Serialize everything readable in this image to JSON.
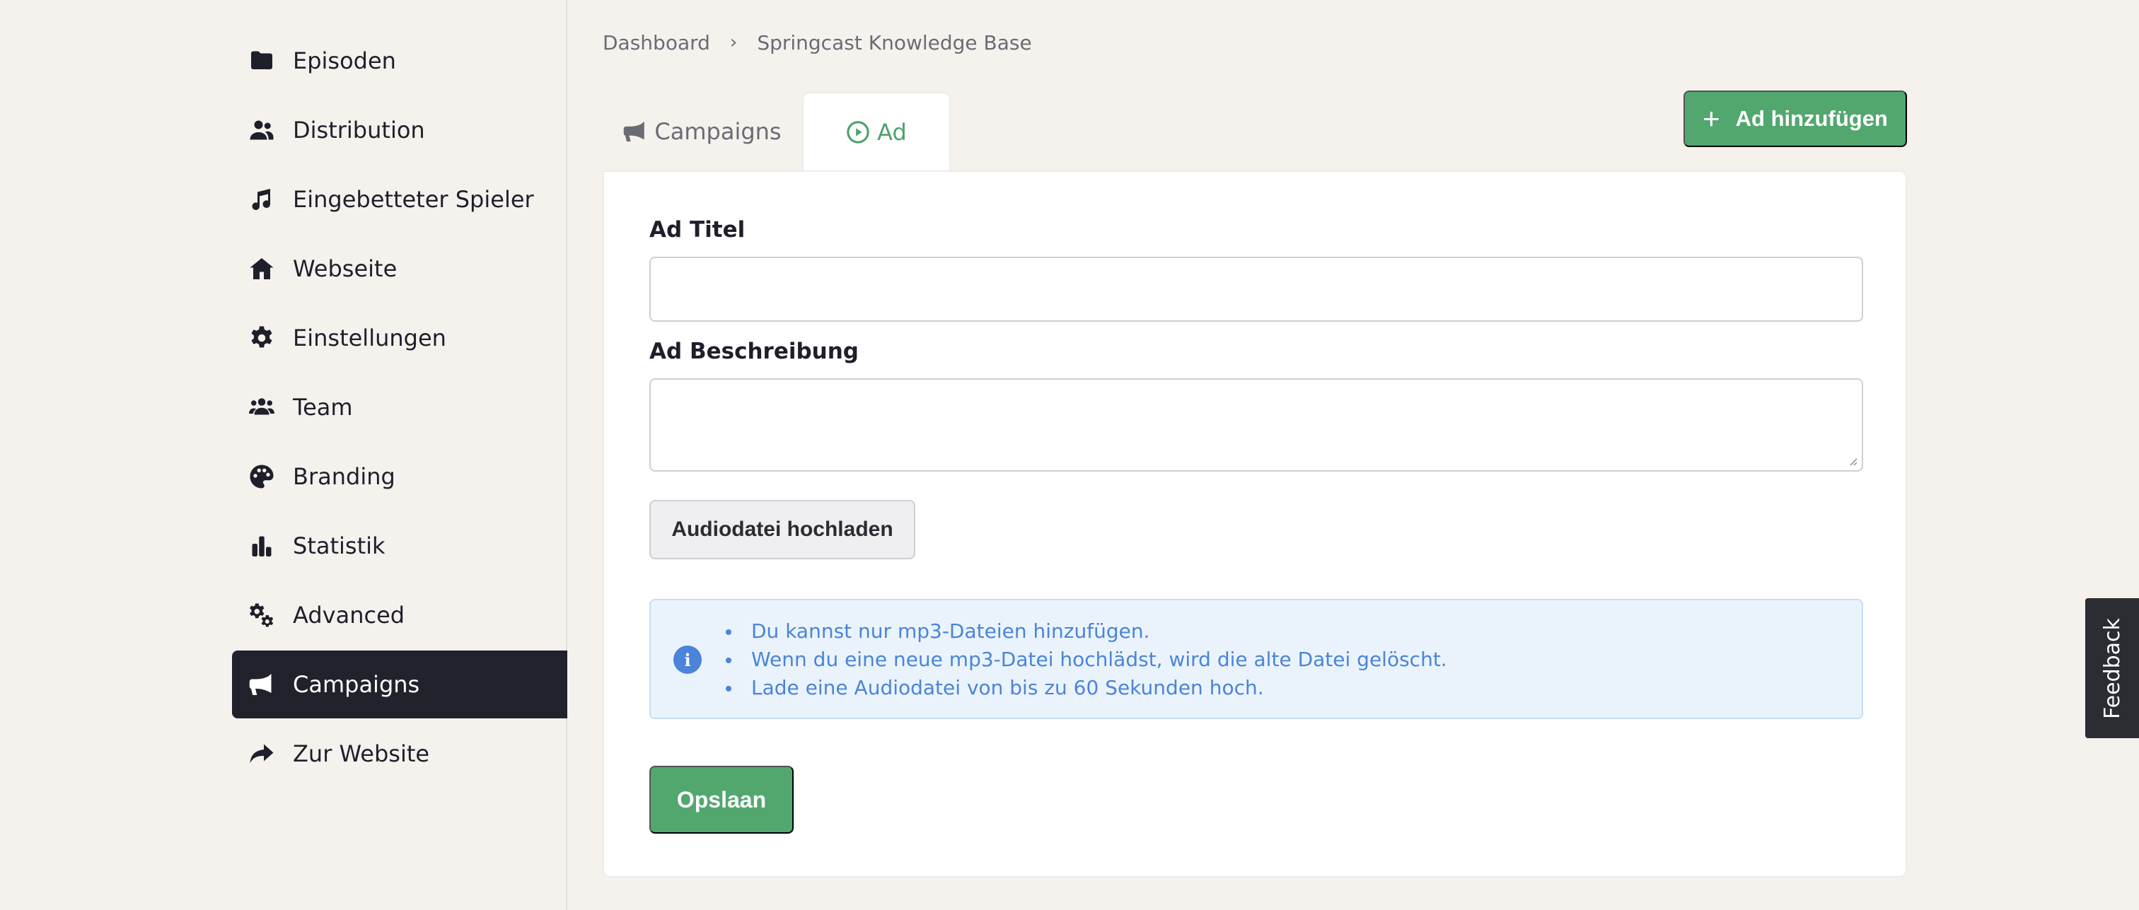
{
  "sidebar": {
    "items": [
      {
        "label": "Episoden",
        "icon": "folder-icon"
      },
      {
        "label": "Distribution",
        "icon": "users-icon"
      },
      {
        "label": "Eingebetteter Spieler",
        "icon": "music-icon"
      },
      {
        "label": "Webseite",
        "icon": "home-icon"
      },
      {
        "label": "Einstellungen",
        "icon": "gear-icon"
      },
      {
        "label": "Team",
        "icon": "team-icon"
      },
      {
        "label": "Branding",
        "icon": "palette-icon"
      },
      {
        "label": "Statistik",
        "icon": "bar-chart-icon"
      },
      {
        "label": "Advanced",
        "icon": "gears-icon"
      },
      {
        "label": "Campaigns",
        "icon": "megaphone-icon",
        "active": true
      },
      {
        "label": "Zur Website",
        "icon": "share-arrow-icon"
      }
    ]
  },
  "breadcrumb": {
    "items": [
      "Dashboard",
      "Springcast Knowledge Base"
    ],
    "separator": "›"
  },
  "tabs": [
    {
      "label": "Campaigns",
      "icon": "megaphone-icon"
    },
    {
      "label": "Ad",
      "icon": "play-circle-icon",
      "active": true
    }
  ],
  "actions": {
    "add_label": "Ad hinzufügen",
    "add_icon": "plus-icon"
  },
  "form": {
    "title_label": "Ad Titel",
    "title_value": "",
    "description_label": "Ad Beschreibung",
    "description_value": "",
    "upload_label": "Audiodatei hochladen",
    "info_items": [
      "Du kannst nur mp3-Dateien hinzufügen.",
      "Wenn du eine neue mp3-Datei hochlädst, wird die alte Datei gelöscht.",
      "Lade eine Audiodatei von bis zu 60 Sekunden hoch."
    ],
    "info_icon_glyph": "i",
    "save_label": "Opslaan"
  },
  "feedback": {
    "label": "Feedback"
  },
  "colors": {
    "accent_green": "#52a76f",
    "sidebar_active": "#22222c",
    "info_blue": "#4b84d8",
    "info_bg": "#eaf3fc"
  }
}
